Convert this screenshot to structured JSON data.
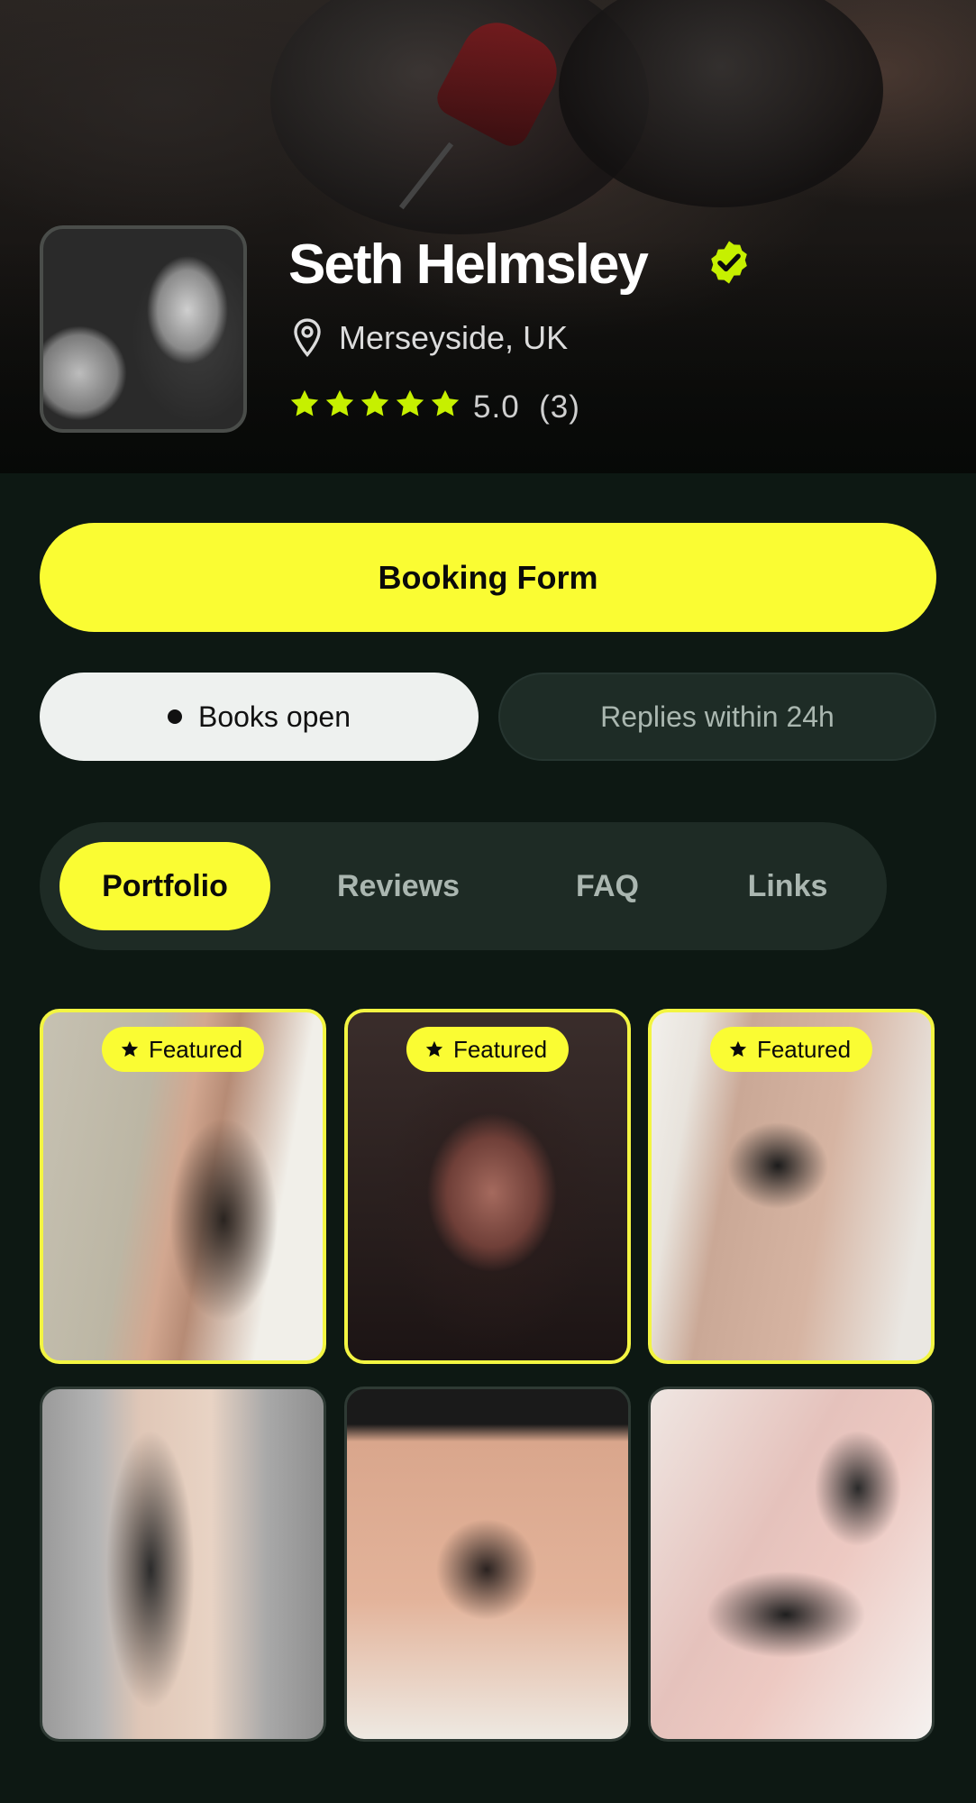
{
  "profile": {
    "name": "Seth Helmsley",
    "location": "Merseyside, UK",
    "rating_value": "5.0",
    "rating_count": "(3)",
    "stars": 5
  },
  "actions": {
    "booking_label": "Booking Form",
    "books_open_label": "Books open",
    "replies_label": "Replies within 24h"
  },
  "tabs": [
    {
      "label": "Portfolio",
      "active": true
    },
    {
      "label": "Reviews",
      "active": false
    },
    {
      "label": "FAQ",
      "active": false
    },
    {
      "label": "Links",
      "active": false
    }
  ],
  "portfolio": {
    "badge_label": "Featured",
    "items": [
      {
        "featured": true
      },
      {
        "featured": true
      },
      {
        "featured": true
      },
      {
        "featured": false
      },
      {
        "featured": false
      },
      {
        "featured": false
      }
    ]
  },
  "colors": {
    "accent": "#fafc33",
    "background": "#0d1813",
    "verified": "#c6f000"
  },
  "icons": {
    "verified": "verified-badge-icon",
    "location": "map-pin-icon",
    "star": "star-icon"
  }
}
